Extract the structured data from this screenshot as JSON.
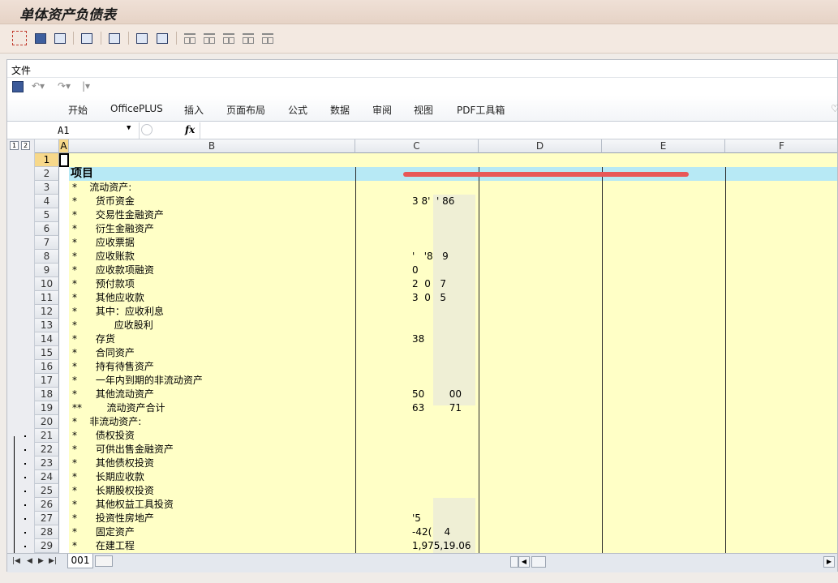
{
  "window": {
    "title": "单体资产负债表"
  },
  "toolbar": {
    "icons": [
      "select-detail-icon",
      "info-icon",
      "layout-icon",
      "filter-icon",
      "columns-icon",
      "print-icon",
      "export-icon",
      "hierarchy-1-icon",
      "hierarchy-2-icon",
      "hierarchy-3-icon",
      "hierarchy-4-icon",
      "hierarchy-5-icon"
    ]
  },
  "excel": {
    "file_menu": "文件",
    "ribbon_tabs": [
      "开始",
      "OfficePLUS",
      "插入",
      "页面布局",
      "公式",
      "数据",
      "审阅",
      "视图",
      "PDF工具箱"
    ],
    "name_box": "A1",
    "fx_label": "fx",
    "outline_levels": [
      "1",
      "2"
    ],
    "columns": [
      "A",
      "B",
      "C",
      "D",
      "E",
      "F"
    ],
    "sheet_tab": "001"
  },
  "rows": [
    {
      "n": "1",
      "b": "",
      "c": ""
    },
    {
      "n": "2",
      "b": "项目",
      "c": ""
    },
    {
      "n": "3",
      "b": "*    流动资产:",
      "c": ""
    },
    {
      "n": "4",
      "b": "*      货币资金",
      "c": "3 8'  ' 86"
    },
    {
      "n": "5",
      "b": "*      交易性金融资产",
      "c": ""
    },
    {
      "n": "6",
      "b": "*      衍生金融资产",
      "c": ""
    },
    {
      "n": "7",
      "b": "*      应收票据",
      "c": ""
    },
    {
      "n": "8",
      "b": "*      应收账款",
      "c": "'   '8   9"
    },
    {
      "n": "9",
      "b": "*      应收款项融资",
      "c": "0"
    },
    {
      "n": "10",
      "b": "*      预付款项",
      "c": "2  0   7"
    },
    {
      "n": "11",
      "b": "*      其他应收款",
      "c": "3  0   5"
    },
    {
      "n": "12",
      "b": "*      其中：应收利息",
      "c": ""
    },
    {
      "n": "13",
      "b": "*            应收股利",
      "c": ""
    },
    {
      "n": "14",
      "b": "*      存货",
      "c": "38"
    },
    {
      "n": "15",
      "b": "*      合同资产",
      "c": ""
    },
    {
      "n": "16",
      "b": "*      持有待售资产",
      "c": ""
    },
    {
      "n": "17",
      "b": "*      一年内到期的非流动资产",
      "c": ""
    },
    {
      "n": "18",
      "b": "*      其他流动资产",
      "c": "50        00"
    },
    {
      "n": "19",
      "b": "**        流动资产合计",
      "c": "63        71"
    },
    {
      "n": "20",
      "b": "*    非流动资产:",
      "c": ""
    },
    {
      "n": "21",
      "b": "*      债权投资",
      "c": ""
    },
    {
      "n": "22",
      "b": "*      可供出售金融资产",
      "c": ""
    },
    {
      "n": "23",
      "b": "*      其他债权投资",
      "c": ""
    },
    {
      "n": "24",
      "b": "*      长期应收款",
      "c": ""
    },
    {
      "n": "25",
      "b": "*      长期股权投资",
      "c": ""
    },
    {
      "n": "26",
      "b": "*      其他权益工具投资",
      "c": ""
    },
    {
      "n": "27",
      "b": "*      投资性房地产",
      "c": "'5"
    },
    {
      "n": "28",
      "b": "*      固定资产",
      "c": "-42(    4"
    },
    {
      "n": "29",
      "b": "*      在建工程",
      "c": "1,975,19.06"
    }
  ]
}
